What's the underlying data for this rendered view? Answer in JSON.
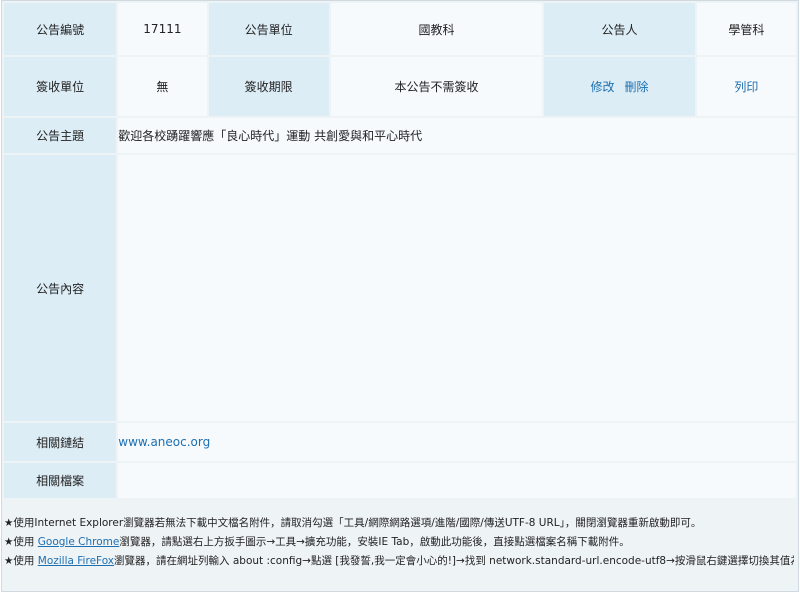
{
  "row1": {
    "id_label": "公告編號",
    "id_value": "17111",
    "unit_label": "公告單位",
    "unit_value": "國教科",
    "publisher_label": "公告人",
    "publisher_value": "學管科"
  },
  "row2": {
    "sign_unit_label": "簽收單位",
    "sign_unit_value": "無",
    "sign_deadline_label": "簽收期限",
    "sign_deadline_value": "本公告不需簽收",
    "edit_label": "修改",
    "delete_label": "刪除",
    "print_label": "列印"
  },
  "subject": {
    "label": "公告主題",
    "value": "歡迎各校踴躍響應「良心時代」運動 共創愛與和平心時代"
  },
  "content": {
    "label": "公告內容",
    "value": ""
  },
  "related_link": {
    "label": "相關鏈結",
    "value": "www.aneoc.org"
  },
  "related_files": {
    "label": "相關檔案",
    "value": ""
  },
  "notes": {
    "star": "★",
    "line1": "使用Internet Explorer瀏覽器若無法下載中文檔名附件，請取消勾選「工具/網際網路選項/進階/國際/傳送UTF-8 URL」，關閉瀏覽器重新啟動即可。",
    "line2_prefix": "使用 ",
    "line2_link": "Google Chrome",
    "line2_suffix": "瀏覽器，請點選右上方扳手圖示→工具→擴充功能，安裝IE Tab，啟動此功能後，直接點選檔案名稱下載附件。",
    "line3_prefix": "使用 ",
    "line3_link": "Mozilla FireFox",
    "line3_suffix": "瀏覽器，請在網址列輸入 about :config→點選 [我發誓,我一定會小心的!]→找到 network.standard-url.encode-utf8→按滑鼠右鍵選擇切換其值為 false 即可。"
  }
}
